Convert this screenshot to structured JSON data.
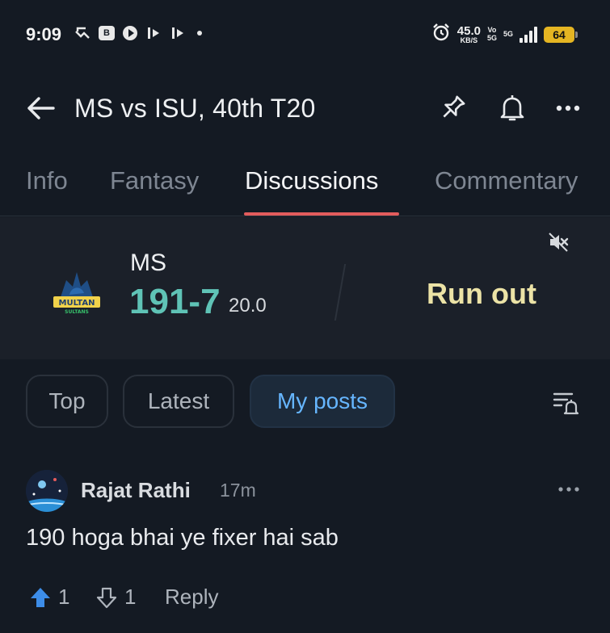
{
  "status_bar": {
    "time": "9:09",
    "notification_box_label": "B",
    "speed_value": "45.0",
    "speed_unit": "KB/S",
    "volte_top": "Vo",
    "volte_bottom": "5G",
    "network": "5G",
    "battery": "64"
  },
  "app_bar": {
    "title": "MS vs ISU, 40th T20"
  },
  "tabs": [
    {
      "label": "Info"
    },
    {
      "label": "Fantasy"
    },
    {
      "label": "Discussions"
    },
    {
      "label": "Commentary"
    }
  ],
  "scorecard": {
    "team": "MS",
    "score": "191-7",
    "overs": "20.0",
    "last_event": "Run out",
    "logo_text_main": "MULTAN",
    "logo_text_sub": "SULTANS"
  },
  "filters": [
    {
      "label": "Top"
    },
    {
      "label": "Latest"
    },
    {
      "label": "My posts"
    }
  ],
  "post": {
    "author": "Rajat Rathi",
    "time": "17m",
    "text": "190 hoga bhai ye fixer hai sab",
    "upvotes": "1",
    "downvotes": "1",
    "reply_label": "Reply"
  },
  "colors": {
    "background": "#141a23",
    "accent_tab": "#e25c5c",
    "score": "#5fc3b6",
    "event": "#ece3a6",
    "link": "#66b6ff"
  }
}
